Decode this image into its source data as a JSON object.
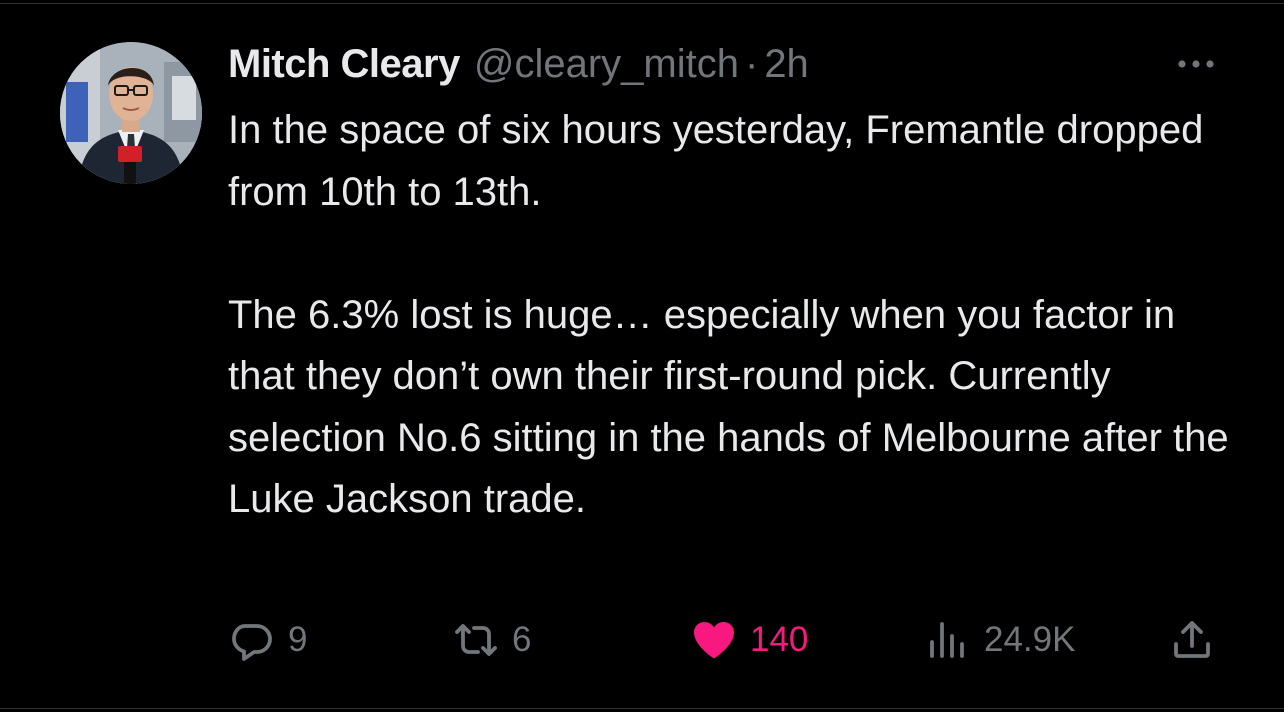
{
  "tweet": {
    "author": {
      "display_name": "Mitch Cleary",
      "handle": "@cleary_mitch"
    },
    "separator": "·",
    "timestamp": "2h",
    "text_paragraphs": [
      "In the space of six hours yesterday, Fremantle dropped from 10th to 13th.",
      "The 6.3% lost is huge… especially when you factor in that they don’t own their first-round pick. Currently selection No.6 sitting in the hands of Melbourne after the Luke Jackson trade."
    ],
    "actions": {
      "replies": "9",
      "retweets": "6",
      "likes": "140",
      "views": "24.9K"
    },
    "liked": true
  },
  "icons": {
    "more": "more-horizontal-icon",
    "reply": "reply-bubble-icon",
    "retweet": "retweet-arrows-icon",
    "like": "heart-icon",
    "views": "views-bar-chart-icon",
    "share": "share-upload-icon"
  },
  "colors": {
    "background": "#000000",
    "text_primary": "#e7e9ea",
    "text_secondary": "#71767b",
    "like_active": "#f91880"
  }
}
